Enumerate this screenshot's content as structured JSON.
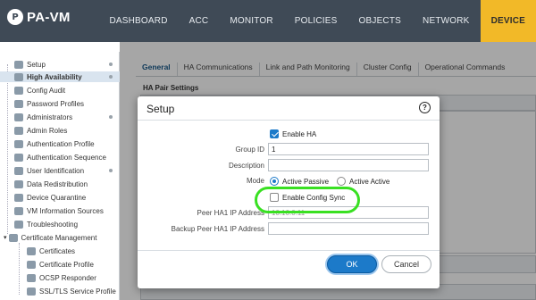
{
  "app": {
    "logo_mark": "P",
    "title": "PA-VM"
  },
  "nav": {
    "tabs": [
      "DASHBOARD",
      "ACC",
      "MONITOR",
      "POLICIES",
      "OBJECTS",
      "NETWORK",
      "DEVICE"
    ],
    "active": "DEVICE"
  },
  "sidebar": {
    "items": [
      {
        "label": "Setup",
        "icon": "setup-icon",
        "dot": true
      },
      {
        "label": "High Availability",
        "icon": "ha-icon",
        "dot": true,
        "active": true
      },
      {
        "label": "Config Audit",
        "icon": "audit-icon"
      },
      {
        "label": "Password Profiles",
        "icon": "password-icon"
      },
      {
        "label": "Administrators",
        "icon": "admin-icon",
        "dot": true
      },
      {
        "label": "Admin Roles",
        "icon": "roles-icon"
      },
      {
        "label": "Authentication Profile",
        "icon": "auth-profile-icon"
      },
      {
        "label": "Authentication Sequence",
        "icon": "auth-seq-icon"
      },
      {
        "label": "User Identification",
        "icon": "user-id-icon",
        "dot": true
      },
      {
        "label": "Data Redistribution",
        "icon": "data-icon"
      },
      {
        "label": "Device Quarantine",
        "icon": "quarantine-icon"
      },
      {
        "label": "VM Information Sources",
        "icon": "vm-icon"
      },
      {
        "label": "Troubleshooting",
        "icon": "troubleshoot-icon"
      },
      {
        "label": "Certificate Management",
        "icon": "cert-mgmt-icon"
      },
      {
        "label": "Certificates",
        "icon": "cert-icon"
      },
      {
        "label": "Certificate Profile",
        "icon": "cert-profile-icon"
      },
      {
        "label": "OCSP Responder",
        "icon": "ocsp-icon"
      },
      {
        "label": "SSL/TLS Service Profile",
        "icon": "ssl-icon"
      }
    ]
  },
  "tabs": [
    "General",
    "HA Communications",
    "Link and Path Monitoring",
    "Cluster Config",
    "Operational Commands"
  ],
  "active_tab": "General",
  "section": {
    "title": "HA Pair Settings"
  },
  "dialog": {
    "title": "Setup",
    "help_symbol": "?",
    "enable_ha": {
      "label": "Enable HA",
      "checked": true
    },
    "group_id": {
      "label": "Group ID",
      "value": "1"
    },
    "description": {
      "label": "Description",
      "value": ""
    },
    "mode": {
      "label": "Mode",
      "options": [
        "Active Passive",
        "Active Active"
      ],
      "selected": "Active Passive"
    },
    "config_sync": {
      "label": "Enable Config Sync",
      "checked": false
    },
    "peer_ha1": {
      "label": "Peer HA1 IP Address",
      "value": "10.10.0.11"
    },
    "backup_peer_ha1": {
      "label": "Backup Peer HA1 IP Address",
      "value": ""
    },
    "ok_label": "OK",
    "cancel_label": "Cancel"
  },
  "colors": {
    "topbar": "#3f4a56",
    "active_nav": "#f2b928",
    "accent": "#1c7ac9",
    "highlight": "#39e022"
  }
}
